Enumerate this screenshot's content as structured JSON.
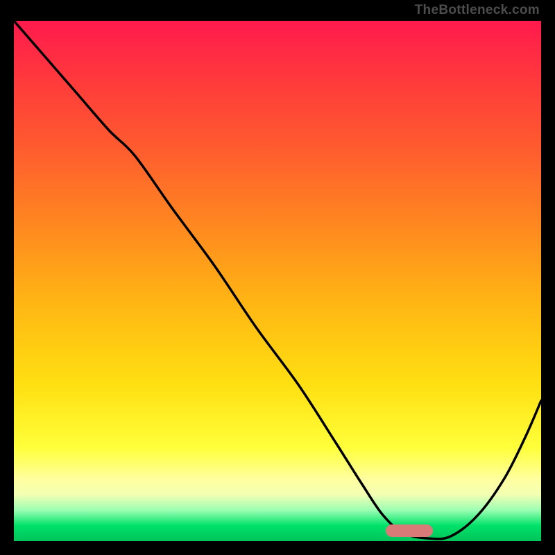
{
  "watermark": "TheBottleneck.com",
  "gradient_colors": {
    "top": "#ff1a4d",
    "mid_upper": "#ff8a1f",
    "mid": "#ffe012",
    "mid_lower": "#ffff9e",
    "bottom": "#00c45a"
  },
  "marker": {
    "x_frac": 0.705,
    "y_frac": 0.98,
    "width_frac": 0.09,
    "color": "#d77a78"
  },
  "chart_data": {
    "type": "line",
    "title": "",
    "xlabel": "",
    "ylabel": "",
    "xlim": [
      0,
      1
    ],
    "ylim": [
      0,
      1
    ],
    "grid": false,
    "series": [
      {
        "name": "curve",
        "x": [
          0.0,
          0.06,
          0.12,
          0.18,
          0.23,
          0.3,
          0.38,
          0.46,
          0.54,
          0.61,
          0.66,
          0.7,
          0.74,
          0.79,
          0.83,
          0.88,
          0.93,
          0.97,
          1.0
        ],
        "y": [
          1.0,
          0.93,
          0.86,
          0.79,
          0.74,
          0.64,
          0.53,
          0.41,
          0.3,
          0.19,
          0.11,
          0.05,
          0.015,
          0.005,
          0.01,
          0.05,
          0.12,
          0.2,
          0.27
        ]
      }
    ],
    "annotations": [
      {
        "type": "pill",
        "x_center": 0.75,
        "y_center": 0.01,
        "width": 0.09
      }
    ]
  }
}
